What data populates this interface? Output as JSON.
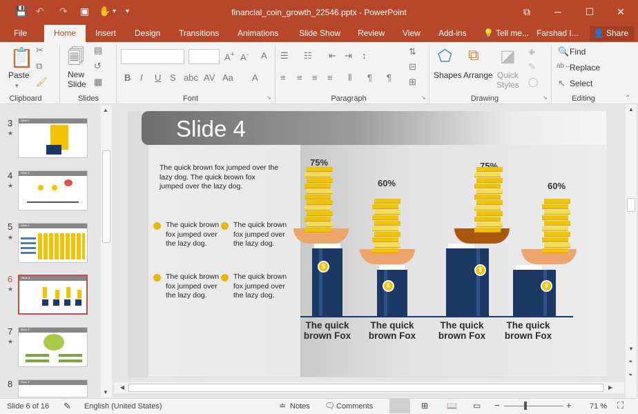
{
  "titlebar": {
    "doc_title": "financial_coin_growth_22546.pptx - PowerPoint",
    "accent": "#b7472a"
  },
  "tabs": [
    "File",
    "Home",
    "Insert",
    "Design",
    "Transitions",
    "Animations",
    "Slide Show",
    "Review",
    "View",
    "Add-ins"
  ],
  "active_tab": "Home",
  "tell_me": "Tell me...",
  "user": "Farshad I...",
  "share": "Share",
  "ribbon": {
    "paste": "Paste",
    "new_slide": "New\nSlide",
    "groups": [
      "Clipboard",
      "Slides",
      "Font",
      "Paragraph",
      "Drawing",
      "Editing"
    ],
    "shapes": "Shapes",
    "arrange": "Arrange",
    "quick_styles": "Quick\nStyles",
    "find": "Find",
    "replace": "Replace",
    "select": "Select"
  },
  "thumbnails": [
    {
      "num": "3",
      "title": "Slide 2"
    },
    {
      "num": "4",
      "title": "Slide 3"
    },
    {
      "num": "5",
      "title": "Slide 4"
    },
    {
      "num": "6",
      "title": "Slide 4",
      "selected": true
    },
    {
      "num": "7",
      "title": "Slide 4"
    },
    {
      "num": "8",
      "title": "Slide 4"
    }
  ],
  "slide": {
    "title": "Slide 4",
    "intro": "The quick brown fox jumped over the lazy dog. The quick brown fox jumped over the lazy dog.",
    "bullets": [
      "The quick brown fox jumped over the lazy dog.",
      "The quick brown fox jumped over the lazy dog.",
      "The quick brown fox jumped over the lazy dog.",
      "The quick brown fox jumped over the lazy dog."
    ],
    "bars": [
      {
        "pct": "75%",
        "coins": 12,
        "caption": "The quick brown Fox",
        "hand": "light"
      },
      {
        "pct": "60%",
        "coins": 10,
        "caption": "The quick brown Fox",
        "hand": "light"
      },
      {
        "pct": "75%",
        "coins": 12,
        "caption": "The quick brown Fox",
        "hand": "dark"
      },
      {
        "pct": "60%",
        "coins": 10,
        "caption": "The quick brown Fox",
        "hand": "light"
      }
    ],
    "medal_symbol": "$"
  },
  "status": {
    "slide_info": "Slide 6 of 16",
    "language": "English (United States)",
    "notes": "Notes",
    "comments": "Comments",
    "zoom": "71 %"
  }
}
